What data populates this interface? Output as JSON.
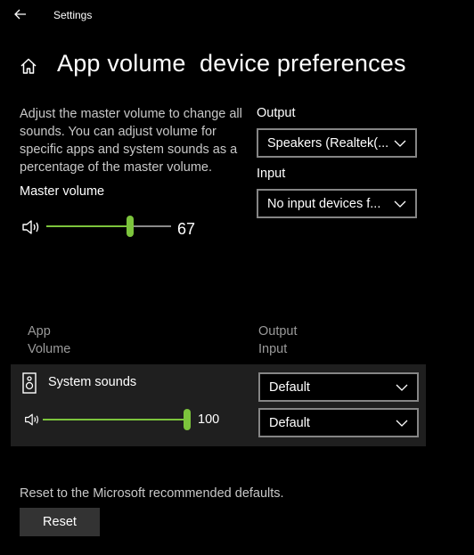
{
  "titlebar": {
    "title": "Settings",
    "back_icon": "back-arrow-icon"
  },
  "page": {
    "title": "App volume  device preferences",
    "home_icon": "home-icon"
  },
  "description": "Adjust the master volume to change all sounds. You can adjust volume for specific apps and system sounds as a percentage of the master volume.",
  "master": {
    "label": "Master volume",
    "value": "67",
    "level": 0.67,
    "speaker_icon": "speaker-icon"
  },
  "output": {
    "label": "Output",
    "selected": "Speakers (Realtek(..."
  },
  "input": {
    "label": "Input",
    "selected": "No input devices f..."
  },
  "app_table": {
    "header_app": "App",
    "header_volume": "Volume",
    "header_output": "Output",
    "header_input": "Input",
    "rows": [
      {
        "name": "System sounds",
        "volume": "100",
        "level": 1.0,
        "output": "Default",
        "input": "Default",
        "icon": "system-sounds-icon"
      }
    ]
  },
  "reset": {
    "text": "Reset to the Microsoft recommended defaults.",
    "button": "Reset"
  },
  "colors": {
    "accent": "#7cc43c",
    "background": "#000000",
    "panel": "#1f1f1f"
  }
}
